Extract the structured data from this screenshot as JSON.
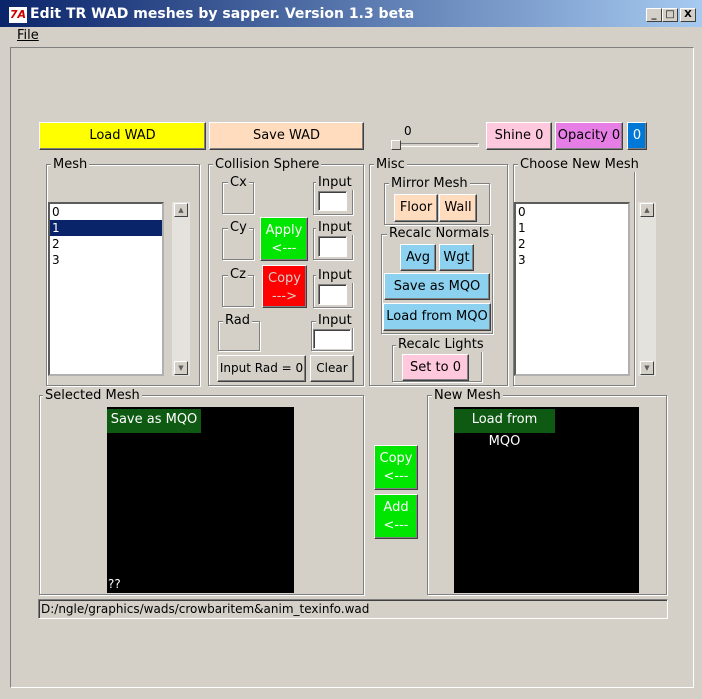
{
  "window": {
    "title": "Edit TR WAD meshes by sapper. Version 1.3 beta",
    "logo": "7A",
    "controls": [
      "_",
      "□",
      "X"
    ]
  },
  "menu": {
    "file": "File"
  },
  "toolbar": {
    "load_wad": "Load WAD",
    "save_wad": "Save WAD",
    "slider_value": "0",
    "slider_level": 0,
    "shine": "Shine 0",
    "opacity": "Opacity 0",
    "extra": "0"
  },
  "mesh_group": {
    "label": "Mesh",
    "items": [
      "0",
      "1",
      "2",
      "3"
    ],
    "selected_index": 1
  },
  "collision": {
    "label": "Collision Sphere",
    "cx": "Cx",
    "cy": "Cy",
    "cz": "Cz",
    "rad": "Rad",
    "input1": "Input",
    "input2": "Input",
    "input3": "Input",
    "input4": "Input",
    "apply_line1": "Apply",
    "apply_line2": "<---",
    "copy_line1": "Copy",
    "copy_line2": "--->",
    "input_rad": "Input Rad = 0",
    "clear": "Clear"
  },
  "misc": {
    "label": "Misc",
    "mirror_label": "Mirror Mesh",
    "floor": "Floor",
    "wall": "Wall",
    "recalc_normals_label": "Recalc Normals",
    "avg": "Avg",
    "wgt": "Wgt",
    "save_mqo": "Save as MQO",
    "load_mqo": "Load from MQO",
    "recalc_lights_label": "Recalc Lights",
    "set_to_0": "Set to 0"
  },
  "choose_group": {
    "label": "Choose New Mesh",
    "items": [
      "0",
      "1",
      "2",
      "3"
    ]
  },
  "selected_mesh": {
    "label": "Selected Mesh",
    "save_mqo": "Save as MQO",
    "corner": "??"
  },
  "center": {
    "copy_line1": "Copy",
    "copy_line2": "<---",
    "add_line1": "Add",
    "add_line2": "<---"
  },
  "new_mesh": {
    "label": "New Mesh",
    "load_mqo": "Load from MQO"
  },
  "status": {
    "path": "D:/ngle/graphics/wads/crowbaritem&anim_texinfo.wad"
  },
  "colors": {
    "load_wad": "#ffff00",
    "peach": "#ffdcbe",
    "pink": "#ffc8dc",
    "violet": "#e67ee6",
    "blue": "#0078d7",
    "green": "#00e600",
    "red": "#ff0000",
    "light_blue": "#8cd2f0",
    "dark_green": "#0f5a12"
  }
}
